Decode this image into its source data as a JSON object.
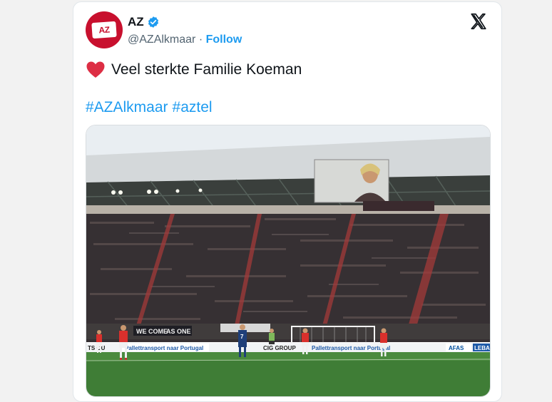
{
  "tweet": {
    "author_name": "AZ",
    "handle": "@AZAlkmaar",
    "separator": "·",
    "follow_label": "Follow",
    "text": "Veel sterkte Familie Koeman",
    "hashtags": [
      "#AZAlkmaar",
      "#aztel"
    ],
    "icons": {
      "avatar": "az-logo-icon",
      "verified": "verified-badge-icon",
      "platform": "x-logo-icon",
      "emoji": "red-heart-icon"
    },
    "avatar_text": "AZ"
  },
  "photo": {
    "banner_text": "WE COME",
    "banner_text_2": "AS ONE",
    "ad_board_1": "Pallettransport naar Portugal",
    "ad_board_2": "CIG GROUP",
    "ad_board_3": "AFAS",
    "ad_board_4": "LEBA",
    "ad_board_5": "TS OU",
    "player_number": "7"
  },
  "colors": {
    "accent": "#1d9bf0",
    "brand_red": "#c8102e",
    "text_primary": "#0f1419",
    "text_secondary": "#536471"
  }
}
